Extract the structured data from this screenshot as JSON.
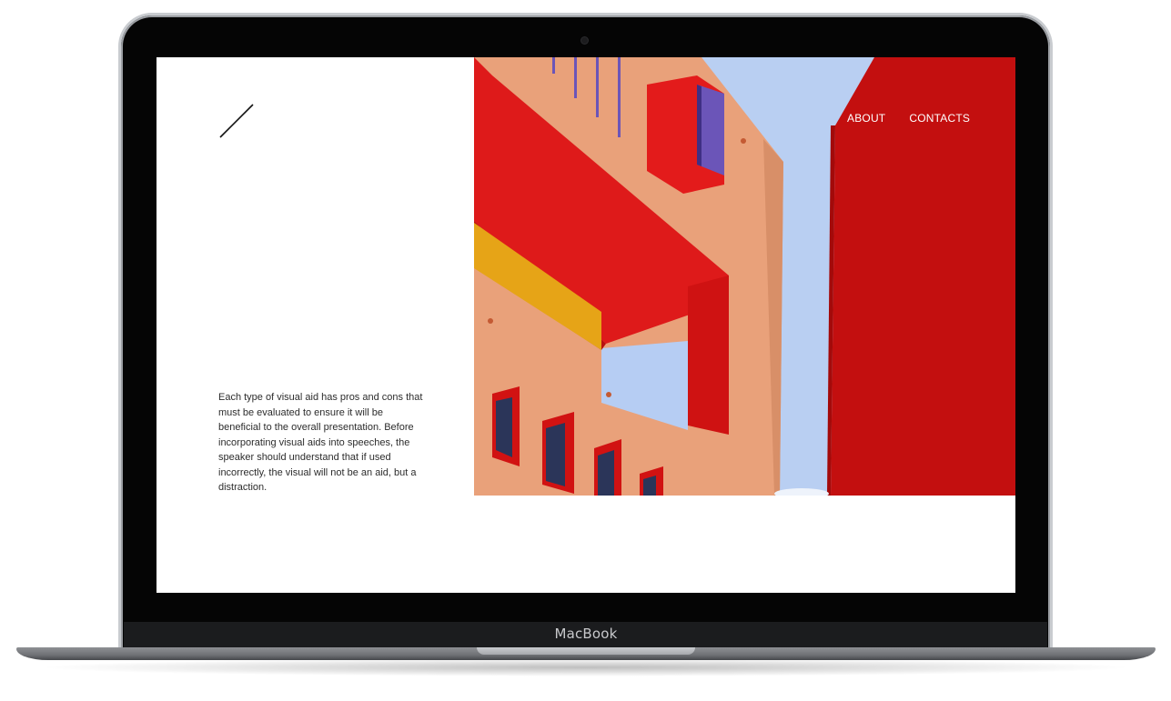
{
  "device": {
    "brand_label": "MacBook"
  },
  "site": {
    "logo_icon": "slash-icon",
    "nav": {
      "items": [
        {
          "label": "ABOUT"
        },
        {
          "label": "CONTACTS"
        }
      ]
    },
    "intro": {
      "text": "Each type of visual aid has pros and cons that must be evaluated to ensure it will be beneficial to the overall presentation. Before incorporating visual aids into speeches, the speaker should understand that if used incorrectly, the visual will not be an aid, but a distraction."
    },
    "hero_image": {
      "subject": "red-and-terracotta-building-against-blue-sky"
    }
  },
  "colors": {
    "sky": "#b9cff2",
    "wall": "#e8a47c",
    "red": "#d71414",
    "yellow": "#e6a417",
    "nav_text": "#ffffff"
  }
}
